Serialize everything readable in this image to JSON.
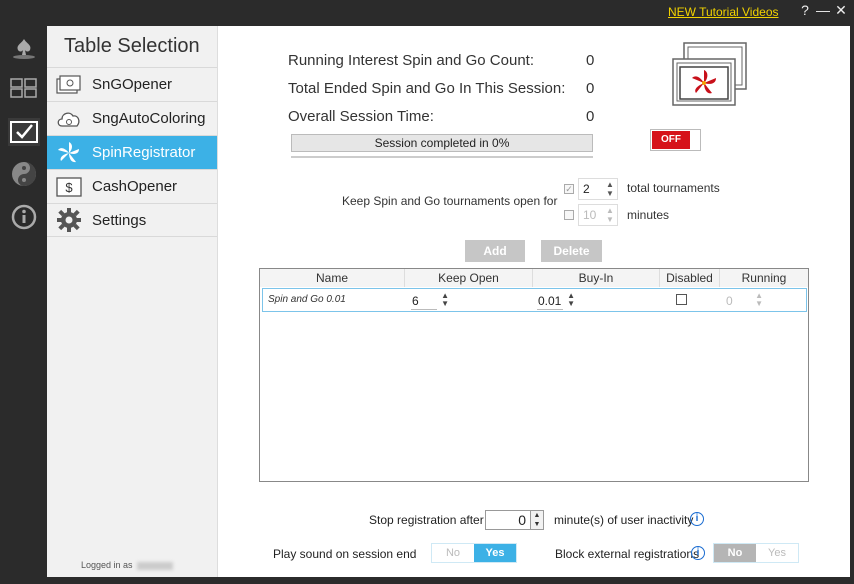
{
  "titlebar": {
    "tutorial_link": "NEW Tutorial Videos",
    "help": "?",
    "minimize": "—",
    "close": "✕"
  },
  "sidebar": {
    "title": "Table Selection",
    "items": [
      {
        "label": "SnGOpener"
      },
      {
        "label": "SngAutoColoring"
      },
      {
        "label": "SpinRegistrator"
      },
      {
        "label": "CashOpener"
      },
      {
        "label": "Settings"
      }
    ],
    "logged_in": "Logged in as"
  },
  "stats": {
    "running_label": "Running Interest Spin and Go Count:",
    "running_value": "0",
    "ended_label": "Total Ended Spin and Go In This Session:",
    "ended_value": "0",
    "time_label": "Overall Session Time:",
    "time_value": "0",
    "progress_text": "Session completed in 0%",
    "progress_percent": 0,
    "toggle_label": "OFF"
  },
  "keep_open": {
    "label": "Keep Spin and Go tournaments open for",
    "total_value": "2",
    "total_label": "total tournaments",
    "total_checked": true,
    "minutes_value": "10",
    "minutes_label": "minutes",
    "minutes_checked": false
  },
  "buttons": {
    "add": "Add",
    "delete": "Delete"
  },
  "grid": {
    "columns": [
      "Name",
      "Keep Open",
      "Buy-In",
      "Disabled",
      "Running"
    ],
    "rows": [
      {
        "name": "Spin and Go 0.01",
        "keep_open": "6",
        "buy_in": "0.01",
        "disabled": false,
        "running": "0"
      }
    ]
  },
  "stop": {
    "label": "Stop registration after",
    "value": "0",
    "suffix": "minute(s) of user inactivity"
  },
  "sound": {
    "label": "Play sound on session end",
    "no": "No",
    "yes": "Yes",
    "selected": "Yes"
  },
  "block": {
    "label": "Block external registrations",
    "no": "No",
    "yes": "Yes",
    "selected": "No"
  },
  "colors": {
    "accent": "#3cb1e6",
    "toggle_off": "#d6121a",
    "link": "#f2d300",
    "dark": "#2b2b2b"
  }
}
